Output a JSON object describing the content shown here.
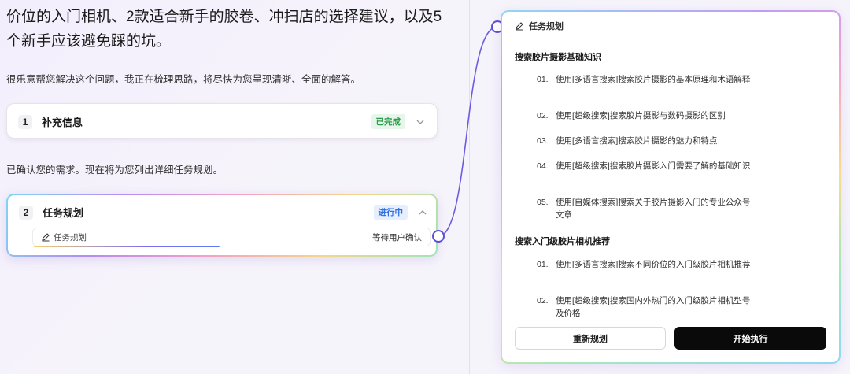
{
  "chat": {
    "heading": "价位的入门相机、2款适合新手的胶卷、冲扫店的选择建议，以及5个新手应该避免踩的坑。",
    "intro": "很乐意帮您解决这个问题，我正在梳理思路，将尽快为您呈现清晰、全面的解答。",
    "confirm": "已确认您的需求。现在将为您列出详细任务规划。",
    "steps": [
      {
        "num": "1",
        "title": "补充信息",
        "status": "已完成"
      },
      {
        "num": "2",
        "title": "任务规划",
        "status": "进行中",
        "sub_label": "任务规划",
        "sub_status": "等待用户确认"
      }
    ]
  },
  "plan": {
    "title": "任务规划",
    "sections": [
      {
        "title": "搜索胶片摄影基础知识",
        "items": [
          {
            "n": "01.",
            "text": "使用[多语言搜索]搜索胶片摄影的基本原理和术语解释"
          },
          {
            "n": "02.",
            "text": "使用[超级搜索]搜索胶片摄影与数码摄影的区别"
          },
          {
            "n": "03.",
            "text": "使用[多语言搜索]搜索胶片摄影的魅力和特点"
          },
          {
            "n": "04.",
            "text": "使用[超级搜索]搜索胶片摄影入门需要了解的基础知识"
          },
          {
            "n": "05.",
            "text": "使用[自媒体搜索]搜索关于胶片摄影入门的专业公众号文章"
          }
        ]
      },
      {
        "title": "搜索入门级胶片相机推荐",
        "items": [
          {
            "n": "01.",
            "text": "使用[多语言搜索]搜索不同价位的入门级胶片相机推荐"
          },
          {
            "n": "02.",
            "text": "使用[超级搜索]搜索国内外热门的入门级胶片相机型号及价格"
          }
        ]
      }
    ],
    "replan_label": "重新规划",
    "execute_label": "开始执行"
  },
  "colors": {
    "done": "#2e9c4e",
    "progress": "#2f6fe0",
    "primary_button": "#0a0a0a"
  },
  "icons": {
    "edit": "pencil-icon",
    "chevron_down": "chevron-down-icon",
    "chevron_up": "chevron-up-icon"
  }
}
